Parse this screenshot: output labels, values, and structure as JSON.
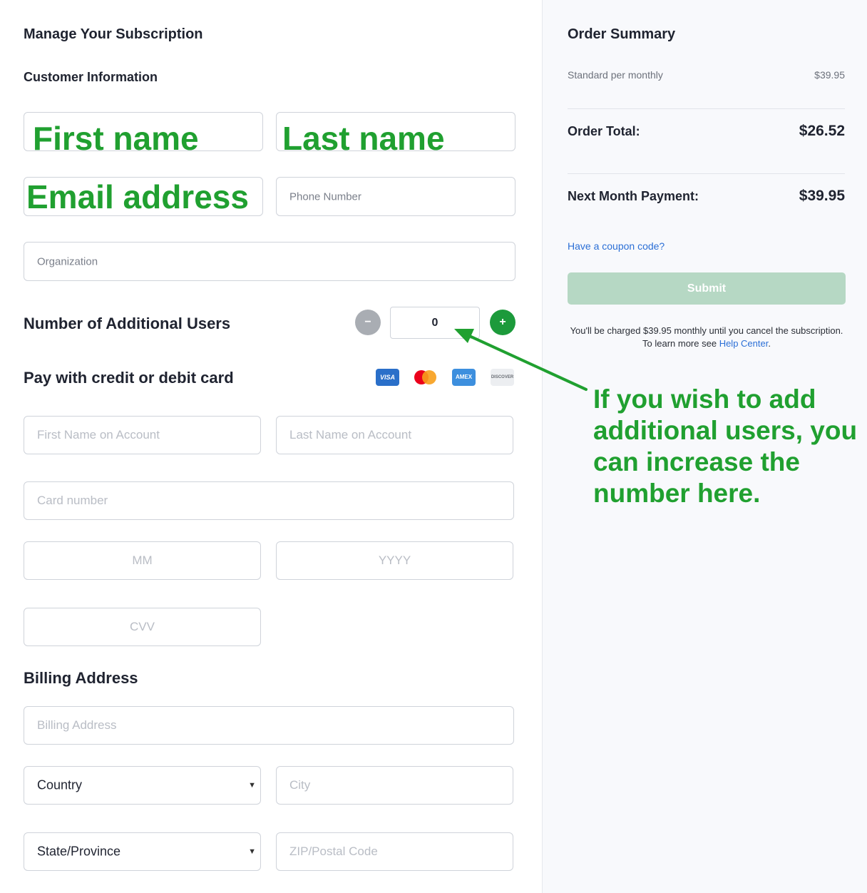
{
  "header": {
    "title": "Manage Your Subscription",
    "customer_info": "Customer Information"
  },
  "customer": {
    "first_name_label": "First name",
    "last_name_label": "Last name",
    "email_label": "Email address",
    "phone_placeholder": "Phone Number",
    "organization_placeholder": "Organization"
  },
  "users": {
    "label": "Number of Additional Users",
    "minus": "−",
    "plus": "+",
    "count": "0"
  },
  "payment": {
    "title": "Pay with credit or debit card",
    "cards": [
      "VISA",
      "mastercard",
      "AMEX",
      "DISCOVER"
    ],
    "first_name_placeholder": "First Name on Account",
    "last_name_placeholder": "Last Name on Account",
    "card_number_placeholder": "Card number",
    "month_placeholder": "MM",
    "year_placeholder": "YYYY",
    "cvv_placeholder": "CVV"
  },
  "billing": {
    "title": "Billing Address",
    "address_placeholder": "Billing Address",
    "country_value": "Country",
    "city_placeholder": "City",
    "state_value": "State/Province",
    "zip_placeholder": "ZIP/Postal Code"
  },
  "summary": {
    "title": "Order Summary",
    "plan_label": "Standard per monthly",
    "plan_price": "$39.95",
    "total_label": "Order Total:",
    "total_value": "$26.52",
    "next_label": "Next Month Payment:",
    "next_value": "$39.95",
    "coupon": "Have a coupon code?",
    "submit": "Submit",
    "note_text": "You'll be charged $39.95 monthly until you cancel the subscription. To learn more see ",
    "note_link": "Help Center",
    "note_end": "."
  },
  "annotation": {
    "callout": "If you wish to add additional users, you can increase the number here."
  },
  "colors": {
    "accent_green": "#1c9a3b",
    "annotation_green": "#20a030",
    "link_blue": "#2b6fd6",
    "submit_disabled": "#b6d8c4"
  }
}
